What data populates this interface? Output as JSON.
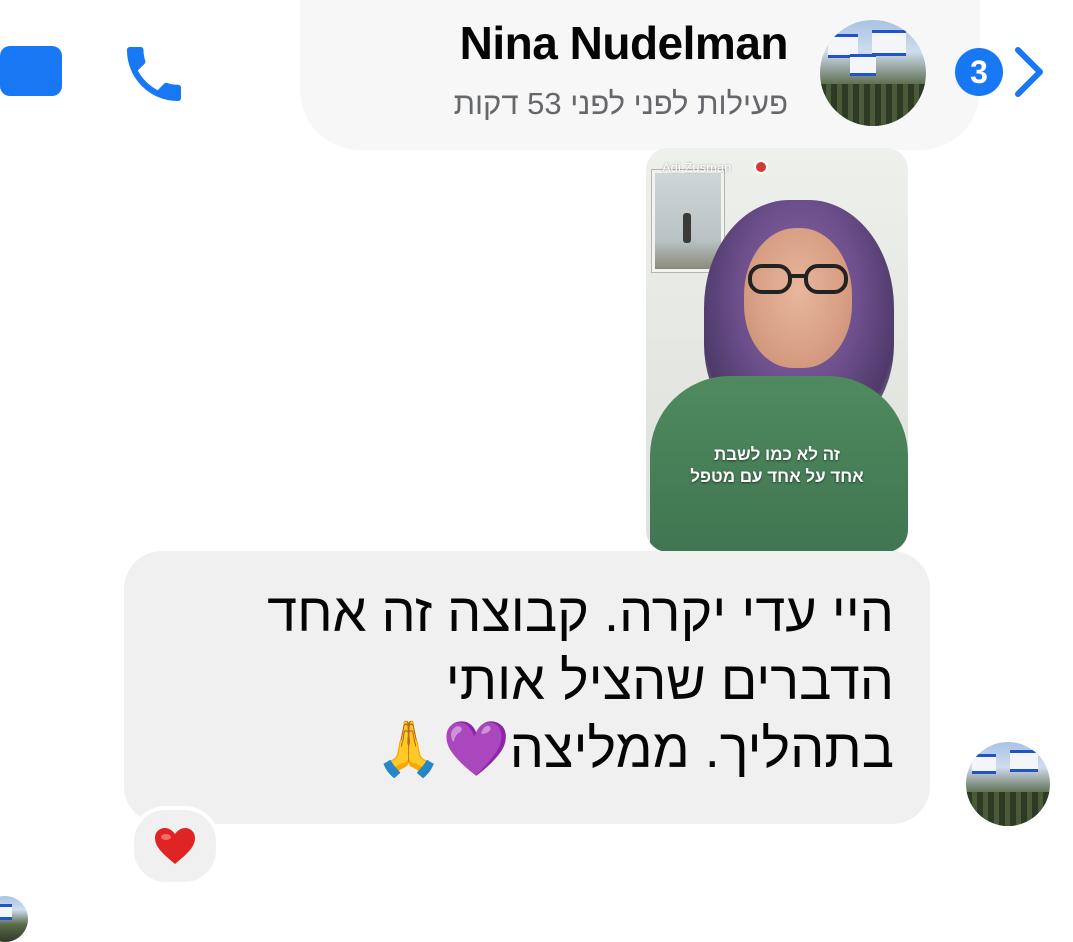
{
  "header": {
    "contact_name": "Nina Nudelman",
    "activity_status": "פעילות לפני לפני 53 דקות",
    "unread_count": "3",
    "accent_color": "#1877f2"
  },
  "shared_reel": {
    "author": "Adi Zusman",
    "caption_line1": "זה לא כמו לשבת",
    "caption_line2": "אחד על אחד עם מטפל"
  },
  "message": {
    "line1": "היי עדי יקרה. קבוצה זה אחד",
    "line2": "הדברים שהציל אותי",
    "line3": "בתהליך. ממליצה💜🙏"
  },
  "reaction": {
    "emoji_name": "red-heart"
  }
}
